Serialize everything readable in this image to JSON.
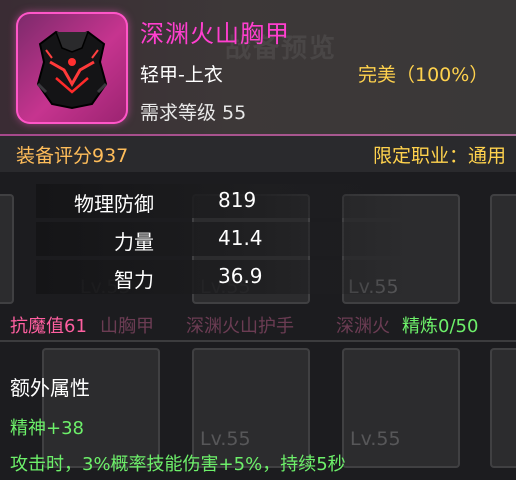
{
  "item": {
    "name": "深渊火山胸甲",
    "type": "轻甲-上衣",
    "quality": "完美（100%）",
    "required_level": "需求等级 55",
    "watermark": "战备预览",
    "icon": "volcanic-chest-armor-icon"
  },
  "score": "装备评分937",
  "class_limit": "限定职业：通用",
  "stats": [
    {
      "name": "物理防御",
      "value": "819"
    },
    {
      "name": "力量",
      "value": "41.4"
    },
    {
      "name": "智力",
      "value": "36.9"
    }
  ],
  "anti_magic": "抗魔值61",
  "refine": "精炼0/50",
  "extra": {
    "title": "额外属性",
    "attribute": "精神+38",
    "effect": "攻击时，3%概率技能伤害+5%，持续5秒"
  },
  "background": {
    "level_labels": [
      "Lv.55",
      "Lv.55",
      "Lv.55",
      "Lv.55",
      "Lv.55",
      "Lv.55"
    ],
    "item_labels": [
      "山胸甲",
      "深渊火山护手",
      "深渊火"
    ]
  },
  "colors": {
    "item_name": "#ff3fcf",
    "quality": "#ffd24d",
    "score": "#ffbd5a",
    "green": "#6df06a",
    "anti_magic": "#ff5fa0"
  }
}
